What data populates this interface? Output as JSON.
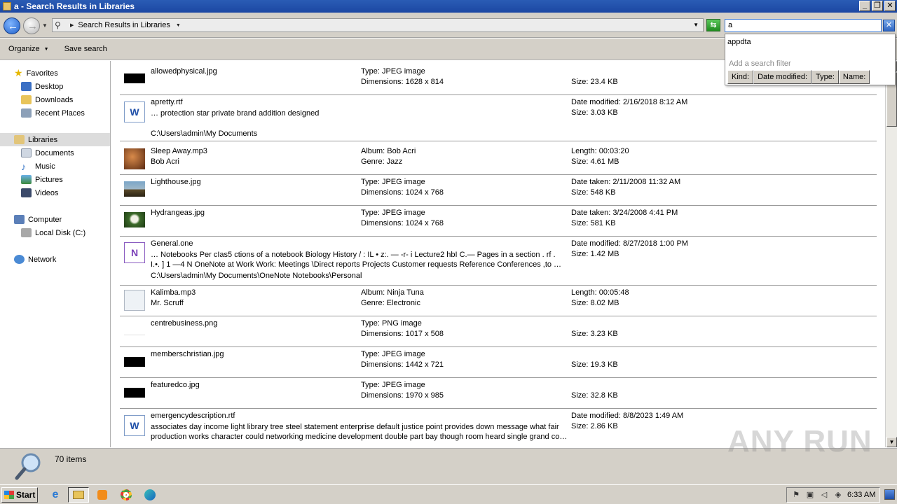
{
  "window": {
    "title": "a - Search Results in Libraries"
  },
  "address_bar": {
    "path": "Search Results in Libraries",
    "search_value": "a"
  },
  "toolbar": {
    "organize": "Organize",
    "save_search": "Save search"
  },
  "nav_pane": {
    "favorites": "Favorites",
    "desktop": "Desktop",
    "downloads": "Downloads",
    "recent_places": "Recent Places",
    "libraries": "Libraries",
    "documents": "Documents",
    "music": "Music",
    "pictures": "Pictures",
    "videos": "Videos",
    "computer": "Computer",
    "local_disk": "Local Disk (C:)",
    "network": "Network"
  },
  "search_dropdown": {
    "suggestion": "appdta",
    "hint": "Add a search filter",
    "filters": [
      "Kind:",
      "Date modified:",
      "Type:",
      "Name:"
    ]
  },
  "results": [
    {
      "name": "allowedphysical.jpg",
      "c2a": "Type: JPEG image",
      "c2b": "Dimensions: 1628 x 814",
      "c3a": "",
      "c3b": "Size: 23.4 KB"
    },
    {
      "name": "apretty.rtf",
      "snippet1": "… protection star private brand addition designed",
      "path": "C:\\Users\\admin\\My Documents",
      "c3a": "Date modified: 2/16/2018 8:12 AM",
      "c3b": "Size: 3.03 KB"
    },
    {
      "name": "Sleep Away.mp3",
      "sub": "Bob Acri",
      "c2a": "Album: Bob Acri",
      "c2b": "Genre: Jazz",
      "c3a": "Length: 00:03:20",
      "c3b": "Size: 4.61 MB"
    },
    {
      "name": "Lighthouse.jpg",
      "c2a": "Type: JPEG image",
      "c2b": "Dimensions: 1024 x 768",
      "c3a": "Date taken: 2/11/2008 11:32 AM",
      "c3b": "Size: 548 KB"
    },
    {
      "name": "Hydrangeas.jpg",
      "c2a": "Type: JPEG image",
      "c2b": "Dimensions: 1024 x 768",
      "c3a": "Date taken: 3/24/2008 4:41 PM",
      "c3b": "Size: 581 KB"
    },
    {
      "name": "General.one",
      "snippet1": "… Notebooks Per cIas5 ctions of a notebook Biology History / : IL • z:. — -r- i Lecture2 hbI C.— Pages in a section . rf .",
      "snippet2": "I.•. ] 1 —4 N OneNote at Work Work: Meetings \\Direct reports Projects Customer requests Reference Conferences ,to …",
      "path": "C:\\Users\\admin\\My Documents\\OneNote Notebooks\\Personal",
      "c3a": "Date modified: 8/27/2018 1:00 PM",
      "c3b": "Size: 1.42 MB"
    },
    {
      "name": "Kalimba.mp3",
      "sub": "Mr. Scruff",
      "c2a": "Album: Ninja Tuna",
      "c2b": "Genre: Electronic",
      "c3a": "Length: 00:05:48",
      "c3b": "Size: 8.02 MB"
    },
    {
      "name": "centrebusiness.png",
      "c2a": "Type: PNG image",
      "c2b": "Dimensions: 1017 x 508",
      "c3a": "",
      "c3b": "Size: 3.23 KB"
    },
    {
      "name": "memberschristian.jpg",
      "c2a": "Type: JPEG image",
      "c2b": "Dimensions: 1442 x 721",
      "c3a": "",
      "c3b": "Size: 19.3 KB"
    },
    {
      "name": "featuredco.jpg",
      "c2a": "Type: JPEG image",
      "c2b": "Dimensions: 1970 x 985",
      "c3a": "",
      "c3b": "Size: 32.8 KB"
    },
    {
      "name": "emergencydescription.rtf",
      "snippet1": "associates day income light library tree steel statement enterprise default justice point provides down message what fair",
      "snippet2": "production works character could networking medicine development double part bay though room heard single grand co…",
      "c3a": "Date modified: 8/8/2023 1:49 AM",
      "c3b": "Size: 2.86 KB"
    }
  ],
  "status": {
    "count": "70 items"
  },
  "watermark": "ANY RUN",
  "taskbar": {
    "start": "Start",
    "clock": "6:33 AM"
  }
}
